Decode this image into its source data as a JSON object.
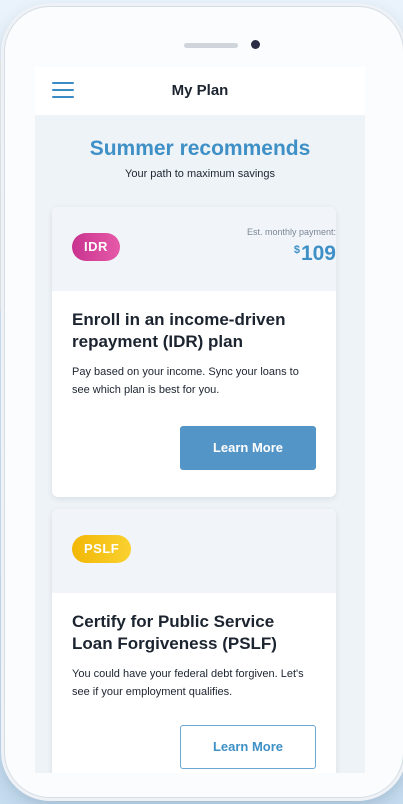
{
  "header": {
    "title": "My Plan"
  },
  "hero": {
    "title": "Summer recommends",
    "subtitle": "Your path to maximum savings"
  },
  "cards": [
    {
      "badge": "IDR",
      "badge_color": "#d0399a",
      "payment_label": "Est. monthly payment:",
      "payment_currency": "$",
      "payment_amount": "109",
      "title": "Enroll in an income-driven repayment (IDR) plan",
      "description": "Pay based on your income. Sync your loans to see which plan is best for you.",
      "button_label": "Learn More",
      "button_style": "filled"
    },
    {
      "badge": "PSLF",
      "badge_color": "#f5c20d",
      "title": "Certify for Public Service Loan Forgiveness (PSLF)",
      "description": "You could have your federal debt forgiven. Let's see if your employment qualifies.",
      "button_label": "Learn More",
      "button_style": "outline"
    }
  ],
  "colors": {
    "accent": "#3e90c6",
    "button": "#5495c8"
  },
  "icons": {
    "menu": "hamburger-menu-icon"
  }
}
